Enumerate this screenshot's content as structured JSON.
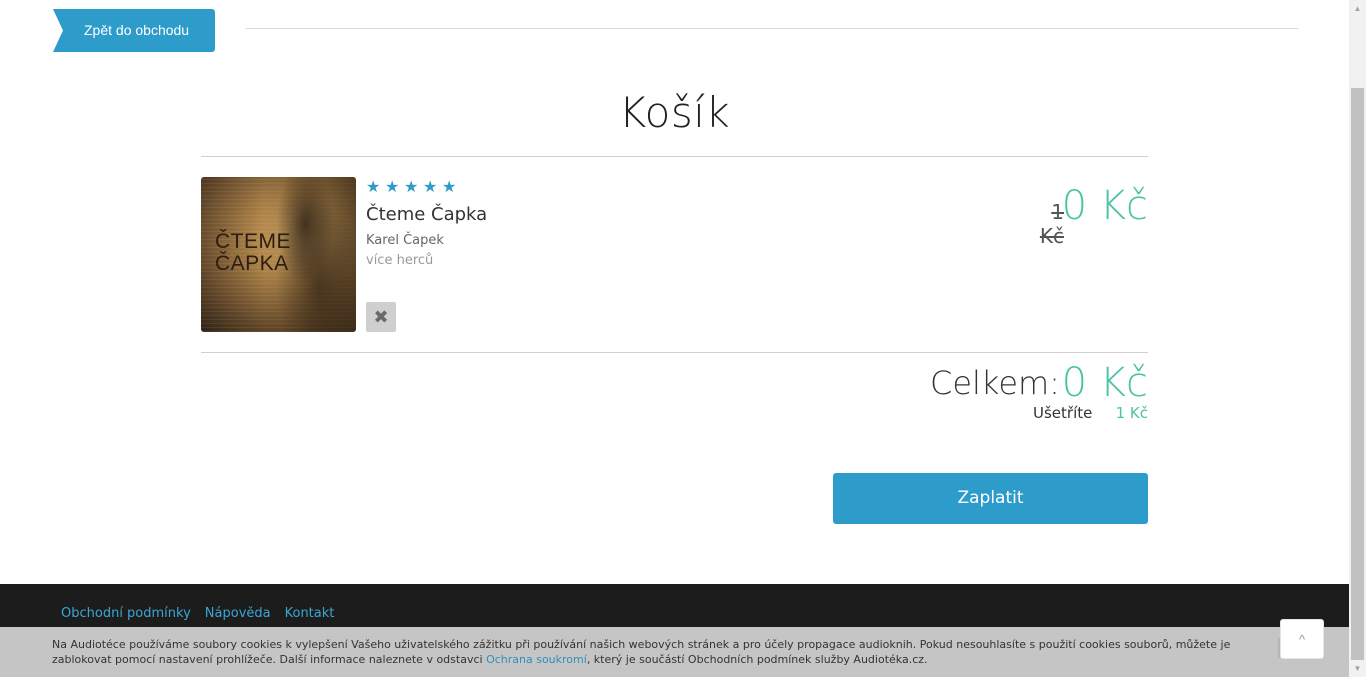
{
  "header": {
    "back_label": "Zpět do obchodu"
  },
  "page_title": "Košík",
  "cart_item": {
    "cover_text": "ČTEME ČAPKA",
    "rating": 5,
    "stars": [
      "★",
      "★",
      "★",
      "★",
      "★"
    ],
    "title": "Čteme Čapka",
    "author": "Karel Čapek",
    "narrator": "více herců",
    "remove_icon": "✖",
    "old_price": "1 Kč",
    "price": "0 Kč"
  },
  "summary": {
    "total_label": "Celkem:",
    "total_value": "0 Kč",
    "savings_label": "Ušetříte",
    "savings_value": "1 Kč"
  },
  "pay_button": "Zaplatit",
  "footer": {
    "links": [
      "Obchodní podmínky",
      "Nápověda",
      "Kontakt"
    ]
  },
  "cookie_bar": {
    "text_before": "Na Audiotéce používáme soubory cookies k vylepšení Vašeho uživatelského zážitku při používání našich webových stránek a pro účely propagace audioknih. Pokud nesouhlasíte s použití cookies souborů, můžete je zablokovat pomocí nastavení prohlížeče. Další informace naleznete v odstavci ",
    "link": "Ochrana soukromí",
    "text_after": ", který je součástí Obchodních podmínek služby Audiotéka.cz.",
    "close_icon": "✖"
  },
  "scroll_top_icon": "^",
  "colors": {
    "accent": "#2e9ccb",
    "price": "#4cc3a1",
    "footer_bg": "#1c1c1c"
  }
}
